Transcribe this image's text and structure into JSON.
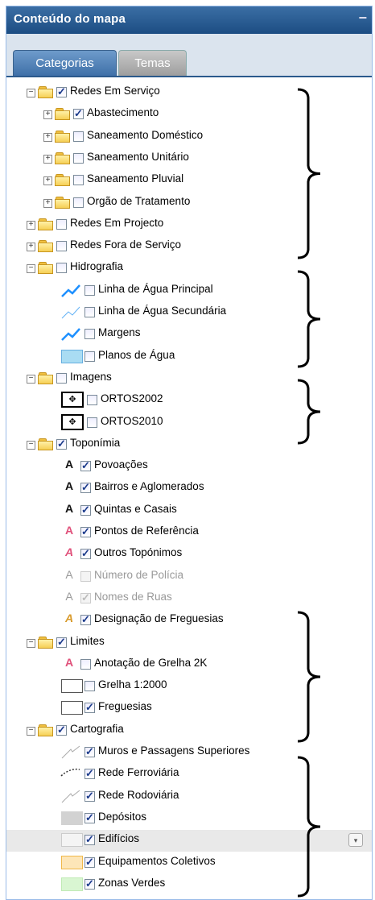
{
  "panel": {
    "title": "Conteúdo do mapa",
    "collapse_glyph": "−"
  },
  "tabs": [
    {
      "label": "Categorias",
      "active": true
    },
    {
      "label": "Temas",
      "active": false
    }
  ],
  "tree": [
    {
      "label": "Redes Em Serviço",
      "checked": true,
      "expander": "−",
      "folder": true,
      "level": 0
    },
    {
      "label": "Abastecimento",
      "checked": true,
      "expander": "+",
      "folder": true,
      "level": 1
    },
    {
      "label": "Saneamento Doméstico",
      "checked": false,
      "expander": "+",
      "folder": true,
      "level": 1
    },
    {
      "label": "Saneamento Unitário",
      "checked": false,
      "expander": "+",
      "folder": true,
      "level": 1
    },
    {
      "label": "Saneamento Pluvial",
      "checked": false,
      "expander": "+",
      "folder": true,
      "level": 1
    },
    {
      "label": "Orgão de Tratamento",
      "checked": false,
      "expander": "+",
      "folder": true,
      "level": 1
    },
    {
      "label": "Redes Em Projecto",
      "checked": false,
      "expander": "+",
      "folder": true,
      "level": 0
    },
    {
      "label": "Redes Fora de Serviço",
      "checked": false,
      "expander": "+",
      "folder": true,
      "level": 0
    },
    {
      "label": "Hidrografia",
      "checked": false,
      "expander": "−",
      "folder": true,
      "level": 0
    },
    {
      "label": "Linha de Água Principal",
      "checked": false,
      "icon": "line-thick-blue-icon",
      "level": 2
    },
    {
      "label": "Linha de Água Secundária",
      "checked": false,
      "icon": "line-thin-blue-icon",
      "level": 2
    },
    {
      "label": "Margens",
      "checked": false,
      "icon": "line-thick-blue-icon",
      "level": 2
    },
    {
      "label": "Planos de Água",
      "checked": false,
      "icon": "swatch-icon",
      "swatch_fill": "#a9dcf3",
      "swatch_border": "#66aee0",
      "level": 2
    },
    {
      "label": "Imagens",
      "checked": false,
      "expander": "−",
      "folder": true,
      "level": 0
    },
    {
      "label": "ORTOS2002",
      "checked": false,
      "icon": "raster-icon",
      "level": 2
    },
    {
      "label": "ORTOS2010",
      "checked": false,
      "icon": "raster-icon",
      "level": 2
    },
    {
      "label": "Toponímia",
      "checked": true,
      "expander": "−",
      "folder": true,
      "level": 0
    },
    {
      "label": "Povoações",
      "checked": true,
      "icon": "letter-a-icon",
      "a_color": "#111111",
      "level": 2
    },
    {
      "label": "Bairros e Aglomerados",
      "checked": true,
      "icon": "letter-a-icon",
      "a_color": "#111111",
      "level": 2
    },
    {
      "label": "Quintas e Casais",
      "checked": true,
      "icon": "letter-a-icon",
      "a_color": "#111111",
      "level": 2
    },
    {
      "label": "Pontos de Referência",
      "checked": true,
      "icon": "letter-a-icon",
      "a_color": "#e0507a",
      "level": 2
    },
    {
      "label": "Outros Topónimos",
      "checked": true,
      "icon": "letter-a-icon",
      "a_color": "#e0507a",
      "italic": true,
      "level": 2
    },
    {
      "label": "Número de Polícia",
      "checked": false,
      "disabled": true,
      "icon": "letter-a-icon",
      "a_color": "#9a9a9a",
      "level": 2
    },
    {
      "label": "Nomes de Ruas",
      "checked": true,
      "disabled": true,
      "icon": "letter-a-icon",
      "a_color": "#9a9a9a",
      "level": 2
    },
    {
      "label": "Designação de Freguesias",
      "checked": true,
      "icon": "letter-a-icon",
      "a_color": "#d89a2a",
      "italic": true,
      "level": 2
    },
    {
      "label": "Limites",
      "checked": true,
      "expander": "−",
      "folder": true,
      "level": 0
    },
    {
      "label": "Anotação de Grelha 2K",
      "checked": false,
      "icon": "letter-a-icon",
      "a_color": "#e0507a",
      "level": 2
    },
    {
      "label": "Grelha 1:2000",
      "checked": false,
      "icon": "swatch-icon",
      "swatch_fill": "#ffffff",
      "swatch_border": "#555555",
      "level": 2
    },
    {
      "label": "Freguesias",
      "checked": true,
      "icon": "swatch-icon",
      "swatch_fill": "#ffffff",
      "swatch_border": "#555555",
      "level": 2
    },
    {
      "label": "Cartografia",
      "checked": true,
      "expander": "−",
      "folder": true,
      "level": 0
    },
    {
      "label": "Muros e Passagens Superiores",
      "checked": true,
      "icon": "line-thin-gray-icon",
      "level": 2
    },
    {
      "label": "Rede Ferroviária",
      "checked": true,
      "icon": "rail-icon",
      "level": 2
    },
    {
      "label": "Rede Rodoviária",
      "checked": true,
      "icon": "line-thin-gray-icon",
      "level": 2
    },
    {
      "label": "Depósitos",
      "checked": true,
      "icon": "swatch-icon",
      "swatch_fill": "#d2d2d2",
      "swatch_border": "#d2d2d2",
      "level": 2
    },
    {
      "label": "Edifícios",
      "checked": true,
      "icon": "swatch-icon",
      "swatch_fill": "#f4f4f4",
      "swatch_border": "#cccccc",
      "selected": true,
      "level": 2
    },
    {
      "label": "Equipamentos Coletivos",
      "checked": true,
      "icon": "swatch-icon",
      "swatch_fill": "#fde6b8",
      "swatch_border": "#f0b84a",
      "level": 2
    },
    {
      "label": "Zonas Verdes",
      "checked": true,
      "icon": "swatch-icon",
      "swatch_fill": "#d9f6d2",
      "swatch_border": "#c0eab5",
      "level": 2
    }
  ],
  "selected_row_menu": {
    "icon": "chevron-down-icon",
    "glyph": "▾"
  },
  "annotations": {
    "brace_count": 6
  }
}
